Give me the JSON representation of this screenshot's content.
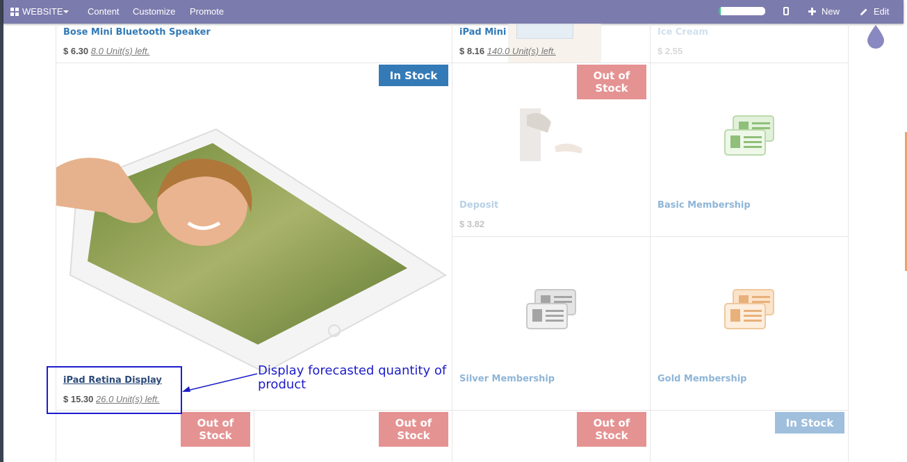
{
  "topbar": {
    "website_label": "WEBSITE",
    "menu": [
      "Content",
      "Customize",
      "Promote"
    ],
    "progress": 0.05,
    "new_label": "New",
    "edit_label": "Edit",
    "bar_color": "#7c7bad"
  },
  "products": [
    {
      "name": "Bose Mini Bluetooth Speaker",
      "price": "$ 6.30",
      "qty": "8.0 Unit(s) left."
    },
    {
      "name": "iPad Mini",
      "price": "$ 8.16",
      "qty": "140.0 Unit(s) left."
    },
    {
      "name": "Ice Cream",
      "price": "$ 2.55"
    },
    {
      "name": "iPad Retina Display",
      "price": "$ 15.30",
      "qty": "26.0 Unit(s) left.",
      "ribbon": "In Stock"
    },
    {
      "name": "Deposit",
      "price": "$ 3.82",
      "ribbon": "Out of Stock"
    },
    {
      "name": "Basic Membership"
    },
    {
      "name": "Silver Membership"
    },
    {
      "name": "Gold Membership"
    }
  ],
  "bottom_ribbons": [
    "Out of Stock",
    "Out of Stock",
    "Out of Stock",
    "In Stock"
  ],
  "annotation": "Display forecasted quantity of product",
  "colors": {
    "link": "#337ab7",
    "in_stock": "#337ab7",
    "out_of_stock": "#e59292",
    "annotation": "#1c1cc8"
  }
}
